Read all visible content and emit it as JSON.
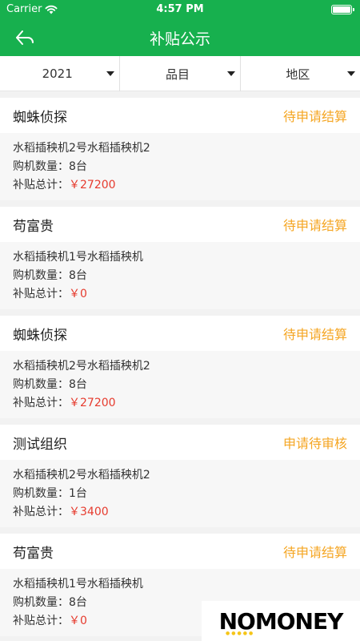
{
  "status_bar": {
    "carrier": "Carrier",
    "time": "4:57 PM"
  },
  "nav": {
    "title": "补贴公示"
  },
  "filters": [
    {
      "label": "2021"
    },
    {
      "label": "品目"
    },
    {
      "label": "地区"
    }
  ],
  "cards": [
    {
      "name": "蜘蛛侦探",
      "status": "待申请结算",
      "machine": "水稻插秧机2号水稻插秧机2",
      "qty_label": "购机数量：",
      "qty": "8台",
      "total_label": "补贴总计：",
      "total": "￥27200"
    },
    {
      "name": "苟富贵",
      "status": "待申请结算",
      "machine": "水稻插秧机1号水稻插秧机",
      "qty_label": "购机数量：",
      "qty": "8台",
      "total_label": "补贴总计：",
      "total": "￥0"
    },
    {
      "name": "蜘蛛侦探",
      "status": "待申请结算",
      "machine": "水稻插秧机2号水稻插秧机2",
      "qty_label": "购机数量：",
      "qty": "8台",
      "total_label": "补贴总计：",
      "total": "￥27200"
    },
    {
      "name": "测试组织",
      "status": "申请待审核",
      "machine": "水稻插秧机2号水稻插秧机2",
      "qty_label": "购机数量：",
      "qty": "1台",
      "total_label": "补贴总计：",
      "total": "￥3400"
    },
    {
      "name": "苟富贵",
      "status": "待申请结算",
      "machine": "水稻插秧机1号水稻插秧机",
      "qty_label": "购机数量：",
      "qty": "8台",
      "total_label": "补贴总计：",
      "total": "￥0"
    }
  ],
  "watermark": {
    "text": "NOMONEY"
  },
  "colors": {
    "header": "#17b04e",
    "status_pending": "#f5a623",
    "money": "#e63b2e"
  }
}
